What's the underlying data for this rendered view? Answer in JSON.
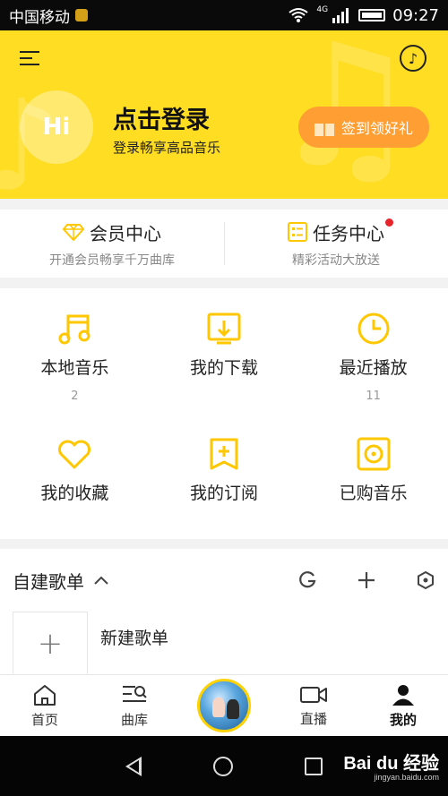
{
  "colors": {
    "brand_yellow": "#ffdd22",
    "accent_orange": "#ff9f33",
    "icon_yellow": "#ffc700",
    "badge_red": "#e8242b"
  },
  "status_bar": {
    "carrier": "中国移动",
    "network": "4G",
    "time": "09:27",
    "icons": [
      "lock-icon",
      "wifi-icon",
      "signal-icon",
      "battery-icon"
    ]
  },
  "header": {
    "menu_icon": "menu-icon",
    "music_icon": "music-note-icon",
    "avatar_text": "Hi",
    "login_title": "点击登录",
    "login_subtitle": "登录畅享高品音乐",
    "signin_label": "签到领好礼"
  },
  "vip": {
    "member": {
      "title": "会员中心",
      "subtitle": "开通会员畅享千万曲库",
      "icon": "diamond-icon"
    },
    "task": {
      "title": "任务中心",
      "subtitle": "精彩活动大放送",
      "icon": "task-list-icon",
      "badge": true
    }
  },
  "grid": [
    {
      "label": "本地音乐",
      "count": "2",
      "icon": "music-note-icon"
    },
    {
      "label": "我的下载",
      "count": "",
      "icon": "download-icon"
    },
    {
      "label": "最近播放",
      "count": "11",
      "icon": "clock-icon"
    },
    {
      "label": "我的收藏",
      "count": "",
      "icon": "heart-icon"
    },
    {
      "label": "我的订阅",
      "count": "",
      "icon": "bookmark-icon"
    },
    {
      "label": "已购音乐",
      "count": "",
      "icon": "purchased-disc-icon"
    }
  ],
  "playlists": {
    "title": "自建歌单",
    "actions": [
      "refresh-icon",
      "add-icon",
      "settings-hex-icon"
    ],
    "new_label": "新建歌单"
  },
  "tabs": [
    {
      "label": "首页",
      "icon": "home-icon"
    },
    {
      "label": "曲库",
      "icon": "library-search-icon"
    },
    {
      "label": "",
      "icon": "now-playing-disc"
    },
    {
      "label": "直播",
      "icon": "video-icon"
    },
    {
      "label": "我的",
      "icon": "user-icon",
      "active": true
    }
  ],
  "watermark": {
    "main": "Bai du 经验",
    "sub": "jingyan.baidu.com"
  }
}
